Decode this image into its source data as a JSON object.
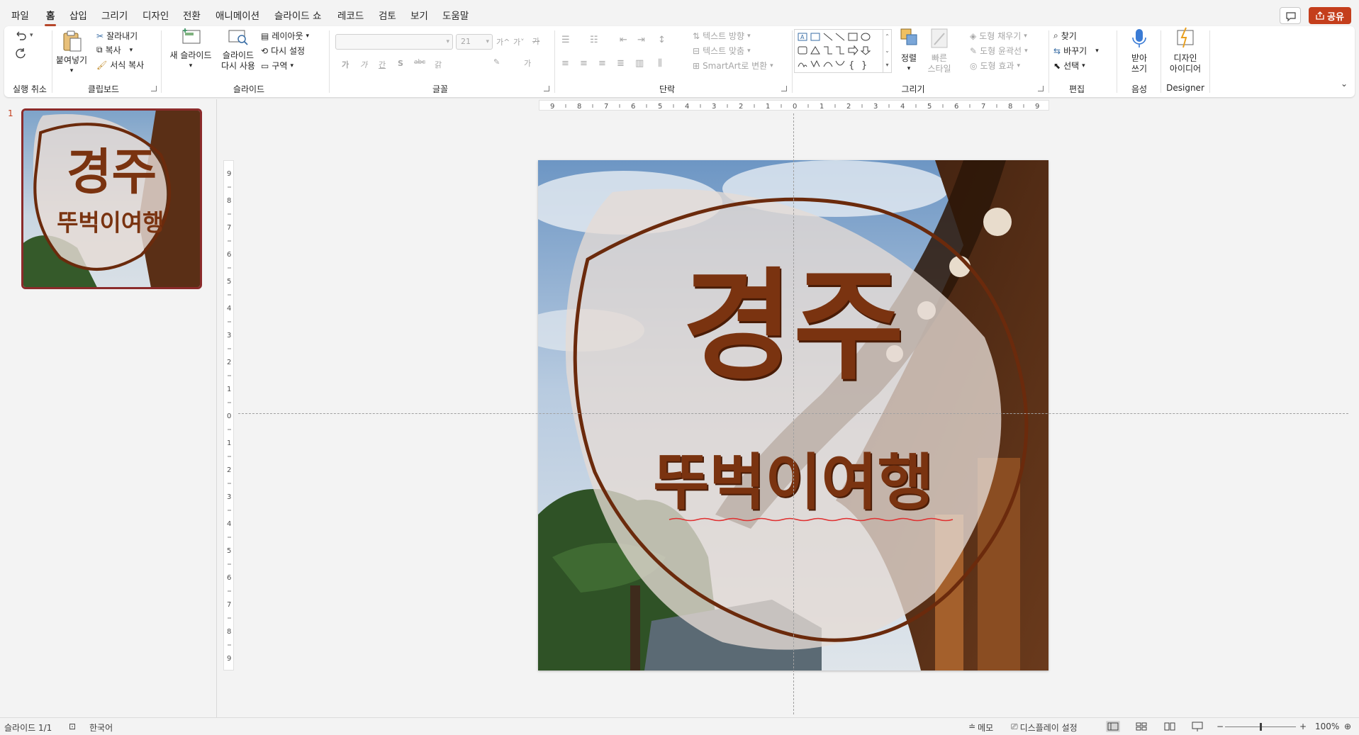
{
  "menu": {
    "tabs": [
      "파일",
      "홈",
      "삽입",
      "그리기",
      "디자인",
      "전환",
      "애니메이션",
      "슬라이드 쇼",
      "레코드",
      "검토",
      "보기",
      "도움말"
    ],
    "active_tab": "홈",
    "share_label": "공유"
  },
  "ribbon": {
    "undo": {
      "label": "실행 취소"
    },
    "clipboard": {
      "paste": "붙여넣기",
      "cut": "잘라내기",
      "copy": "복사",
      "format_painter": "서식 복사",
      "label": "클립보드"
    },
    "slides": {
      "new_slide": "새 슬라이드",
      "reuse_slide": "슬라이드 다시 사용",
      "reuse_line1": "슬라이드",
      "reuse_line2": "다시 사용",
      "layout": "레이아웃",
      "reset": "다시 설정",
      "section": "구역",
      "label": "슬라이드"
    },
    "font": {
      "font_name_value": "",
      "font_size_value": "21",
      "increase_size": "가^",
      "decrease_size": "가˅",
      "clear_format": "가",
      "bold": "가",
      "italic": "가",
      "underline": "간",
      "strikethrough": "S",
      "char_spacing": "abc",
      "case": "갉",
      "label": "글꼴"
    },
    "paragraph": {
      "text_direction": "텍스트 방향",
      "align_text": "텍스트 맞춤",
      "smartart": "SmartArt로 변환",
      "label": "단락"
    },
    "drawing": {
      "arrange": "정렬",
      "quick_styles_line1": "빠른",
      "quick_styles_line2": "스타일",
      "fill": "도형 채우기",
      "outline": "도형 윤곽선",
      "effects": "도형 효과",
      "label": "그리기"
    },
    "editing": {
      "find": "찾기",
      "replace": "바꾸기",
      "select": "선택",
      "label": "편집"
    },
    "voice": {
      "dictate_line1": "받아",
      "dictate_line2": "쓰기",
      "label": "음성"
    },
    "designer": {
      "ideas_line1": "디자인",
      "ideas_line2": "아이디어",
      "label": "Designer"
    }
  },
  "ruler": {
    "horizontal": [
      "9",
      "8",
      "7",
      "6",
      "5",
      "4",
      "3",
      "2",
      "1",
      "0",
      "1",
      "2",
      "3",
      "4",
      "5",
      "6",
      "7",
      "8",
      "9"
    ],
    "vertical": [
      "9",
      "8",
      "7",
      "6",
      "5",
      "4",
      "3",
      "2",
      "1",
      "0",
      "1",
      "2",
      "3",
      "4",
      "5",
      "6",
      "7",
      "8",
      "9"
    ]
  },
  "slides_panel": {
    "number": "1"
  },
  "slide": {
    "title": "경주",
    "subtitle": "뚜벅이여행",
    "title_color": "#7a3310",
    "circle_outline_color": "#6b2a0c"
  },
  "status": {
    "slide_count": "슬라이드 1/1",
    "language": "한국어",
    "notes": "메모",
    "display_settings": "디스플레이 설정",
    "zoom_minus": "−",
    "zoom_plus": "+",
    "zoom_level": "100%",
    "zoom_fraction": 0.5
  },
  "colors": {
    "accent": "#c43e1c",
    "thumb_border": "#8b2b2b"
  }
}
